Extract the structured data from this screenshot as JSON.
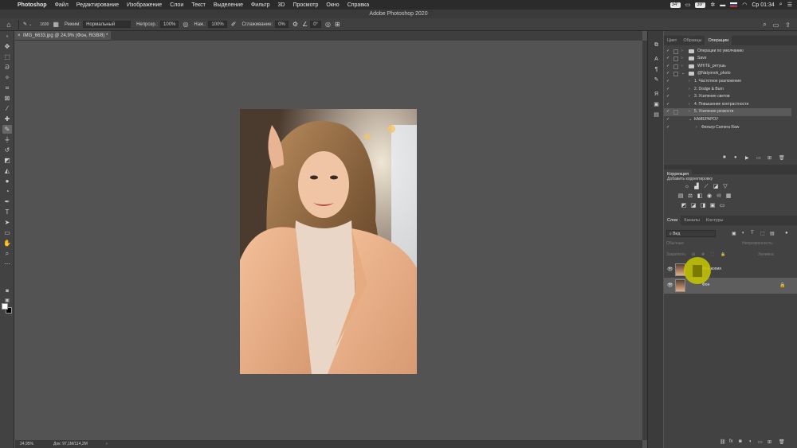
{
  "menubar": {
    "app": "Photoshop",
    "items": [
      "Файл",
      "Редактирование",
      "Изображение",
      "Слои",
      "Текст",
      "Выделение",
      "Фильтр",
      "3D",
      "Просмотр",
      "Окно",
      "Справка"
    ],
    "temp1": "34°",
    "temp2": "39°",
    "clock": "Ср 01:34"
  },
  "window": {
    "title": "Adobe Photoshop 2020"
  },
  "options": {
    "brush_size": "1600",
    "mode_label": "Режим:",
    "mode_value": "Нормальный",
    "opacity_label": "Непрозр.:",
    "opacity_value": "100%",
    "pressure_label": "Наж.:",
    "pressure_value": "100%",
    "smoothing_label": "Сглаживание:",
    "smoothing_value": "0%",
    "angle_value": "0°"
  },
  "document": {
    "tab_title": "IMG_6633.jpg @ 24,9% (Фон, RGB/8) *",
    "zoom": "24,95%",
    "doc_info": "Док: 97,1M/114,2M"
  },
  "panels": {
    "top_tabs": [
      "Цвет",
      "Образцы",
      "Операции"
    ],
    "actions": [
      {
        "label": "Операции по умолчанию",
        "level": 0,
        "folder": true,
        "expanded": false,
        "checked": true,
        "selected": false
      },
      {
        "label": "Save",
        "level": 0,
        "folder": true,
        "expanded": false,
        "checked": true,
        "selected": false
      },
      {
        "label": "WHITE_ретушь",
        "level": 0,
        "folder": true,
        "expanded": false,
        "checked": true,
        "selected": false
      },
      {
        "label": "@Natyonok_photo",
        "level": 0,
        "folder": true,
        "expanded": true,
        "checked": true,
        "selected": false
      },
      {
        "label": "1. Частотное разложение",
        "level": 1,
        "folder": false,
        "expanded": false,
        "checked": true,
        "selected": false
      },
      {
        "label": "2. Dodge & Burn",
        "level": 1,
        "folder": false,
        "expanded": false,
        "checked": true,
        "selected": false
      },
      {
        "label": "3. Усиление светов",
        "level": 1,
        "folder": false,
        "expanded": false,
        "checked": true,
        "selected": false
      },
      {
        "label": "4. Повышение контрастности",
        "level": 1,
        "folder": false,
        "expanded": false,
        "checked": true,
        "selected": false
      },
      {
        "label": "5. Усиление резкости",
        "level": 1,
        "folder": false,
        "expanded": false,
        "checked": true,
        "selected": true
      },
      {
        "label": "КАМЕРАРОУ",
        "level": 1,
        "folder": false,
        "expanded": true,
        "checked": true,
        "selected": false
      },
      {
        "label": "Фильтр Camera Raw",
        "level": 2,
        "folder": false,
        "expanded": false,
        "checked": true,
        "selected": false
      }
    ],
    "correction_tab": "Коррекция",
    "correction_hint": "Добавить корректировку",
    "layers_tabs": [
      "Слои",
      "Каналы",
      "Контуры"
    ],
    "layer_filter": "Вид",
    "blend_mode": "Обычные",
    "opacity_label": "Непрозрачность:",
    "lock_label": "Закрепить:",
    "fill_label": "Заливка:",
    "layers": [
      {
        "name": "Фон копия",
        "selected": false
      },
      {
        "name": "Фон",
        "selected": true
      }
    ]
  },
  "colors": {
    "foreground": "#ffffff",
    "background": "#000000"
  }
}
